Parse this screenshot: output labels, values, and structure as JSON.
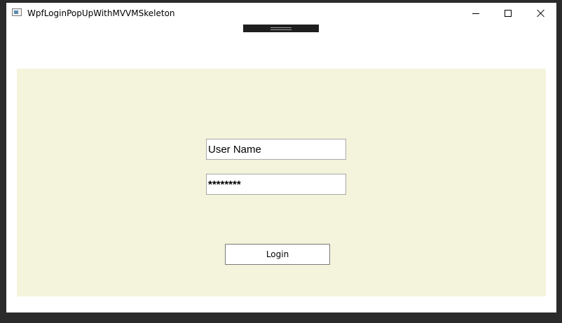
{
  "window": {
    "title": "WpfLoginPopUpWithMVVMSkeleton"
  },
  "icons": {
    "app": "app-window-icon",
    "minimize": "minimize-icon",
    "maximize": "maximize-icon",
    "close": "close-icon",
    "debug_toolbar": "xaml-debug-toolbar-grip-icon"
  },
  "login": {
    "username_value": "User Name",
    "password_value": "********",
    "login_label": "Login"
  },
  "colors": {
    "panel_background": "#f4f4dc",
    "window_background": "#ffffff",
    "frame": "#2b2b2b",
    "toolbar": "#1e1e1e"
  }
}
